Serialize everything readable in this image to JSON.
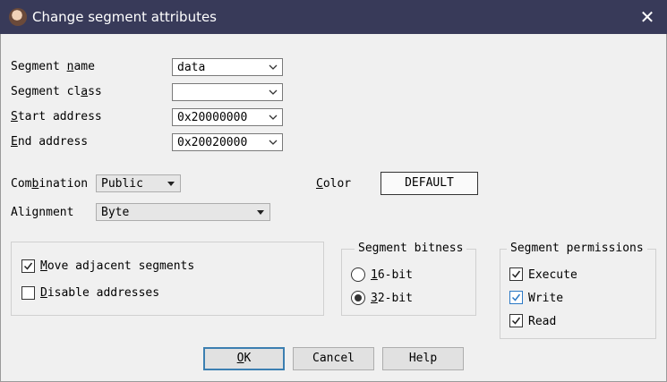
{
  "window": {
    "title": "Change segment attributes",
    "close_glyph": "✕"
  },
  "fields": {
    "segment_name": {
      "label_pre": "Segment ",
      "label_u": "n",
      "label_post": "ame",
      "value": "data"
    },
    "segment_class": {
      "label_pre": "Segment cl",
      "label_u": "a",
      "label_post": "ss",
      "value": ""
    },
    "start_address": {
      "label_pre": "",
      "label_u": "S",
      "label_post": "tart address",
      "value": "0x20000000"
    },
    "end_address": {
      "label_pre": "",
      "label_u": "E",
      "label_post": "nd address",
      "value": "0x20020000"
    }
  },
  "combination": {
    "label_pre": "Com",
    "label_u": "b",
    "label_post": "ination",
    "value": "Public"
  },
  "color": {
    "label_pre": "",
    "label_u": "C",
    "label_post": "olor",
    "button": "DEFAULT"
  },
  "alignment": {
    "label": "Alignment",
    "value": "Byte"
  },
  "options": {
    "move_adjacent": {
      "label_u": "M",
      "label_post": "ove adjacent segments",
      "checked": true
    },
    "disable_addresses": {
      "label_u": "D",
      "label_post": "isable addresses",
      "checked": false
    }
  },
  "bitness": {
    "title": "Segment bitness",
    "opt16": {
      "label_u": "1",
      "label_post": "6-bit",
      "selected": false
    },
    "opt32": {
      "label_u": "3",
      "label_post": "2-bit",
      "selected": true
    }
  },
  "permissions": {
    "title": "Segment permissions",
    "execute": {
      "label": "Execute",
      "checked": true
    },
    "write": {
      "label": "Write",
      "checked": true
    },
    "read": {
      "label": "Read",
      "checked": true
    }
  },
  "buttons": {
    "ok_u": "O",
    "ok_post": "K",
    "cancel": "Cancel",
    "help": "Help"
  },
  "colors": {
    "titlebar": "#383a59",
    "default_button_border": "#3c7fb1",
    "focus_checkbox": "#2a78c5"
  }
}
